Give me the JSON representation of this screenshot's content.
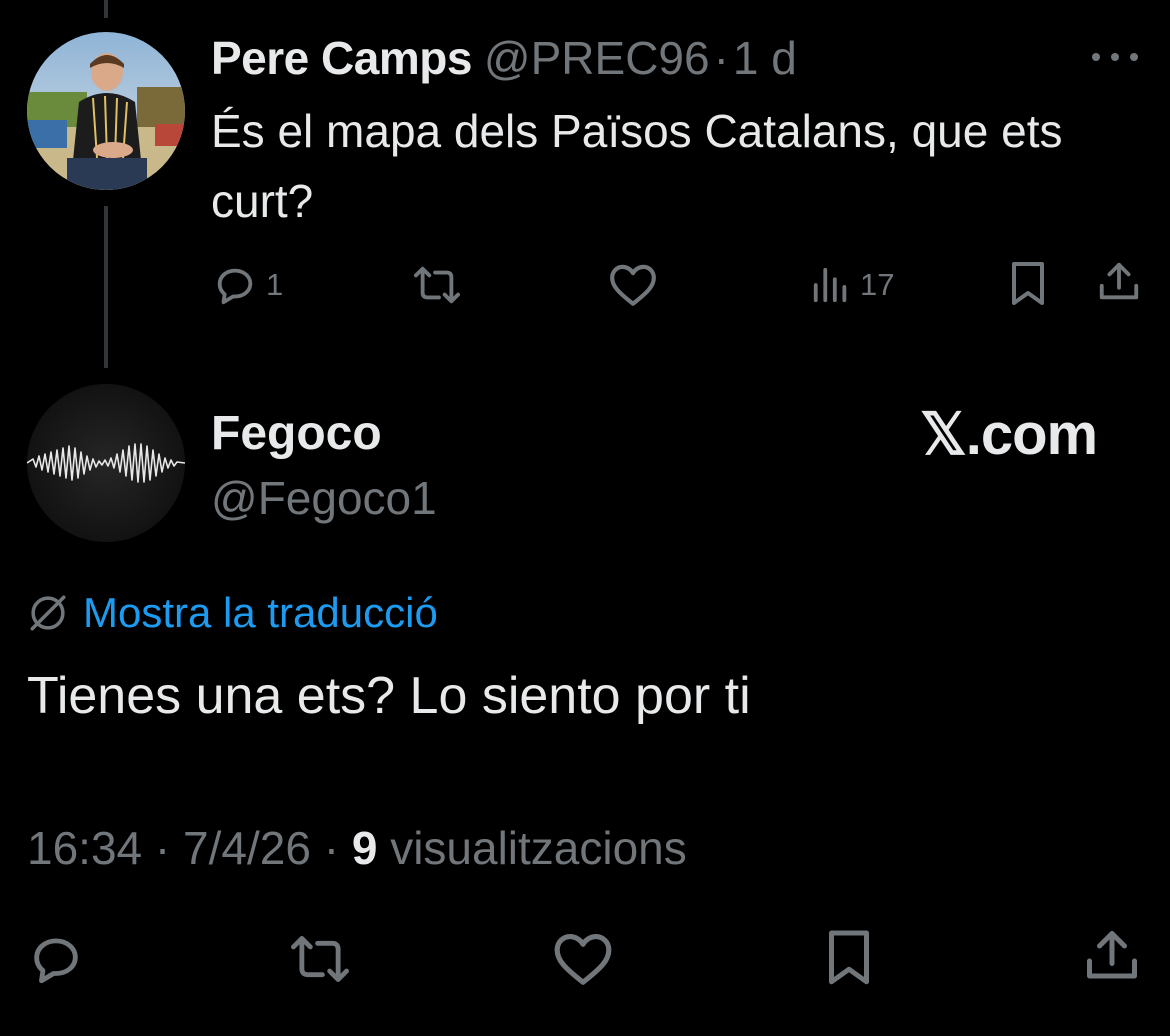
{
  "reply_tweet": {
    "display_name": "Pere Camps",
    "handle": "@PREC96",
    "separator": "·",
    "time_ago": "1 d",
    "text": "És el mapa dels Països Catalans, que ets curt?",
    "actions": {
      "reply_count": "1",
      "views_count": "17"
    },
    "icons": {
      "reply": "reply-icon",
      "retweet": "retweet-icon",
      "like": "heart-icon",
      "views": "views-icon",
      "bookmark": "bookmark-icon",
      "share": "share-icon",
      "more": "more-icon"
    }
  },
  "main_tweet": {
    "display_name": "Fegoco",
    "handle": "@Fegoco1",
    "watermark": "𝕏.com",
    "translate_label": "Mostra la traducció",
    "text": "Tienes una ets? Lo siento por ti",
    "time": "16:34",
    "date": "7/4/26",
    "separator": "·",
    "views_count": "9",
    "views_label": "visualitzacions"
  },
  "colors": {
    "background": "#000000",
    "text_primary": "#e7e9ea",
    "text_secondary": "#71767b",
    "link_blue": "#1d9bf0",
    "thread_line": "#333639"
  }
}
